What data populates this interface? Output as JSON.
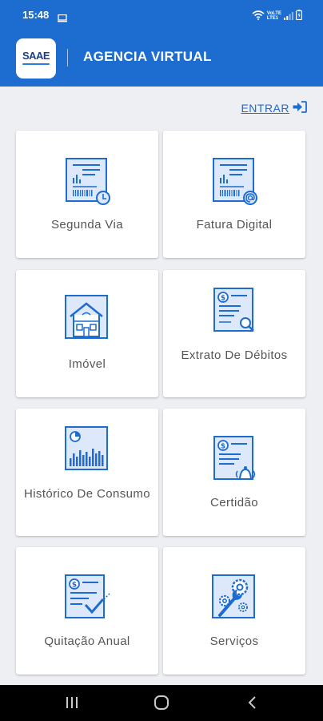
{
  "status_bar": {
    "time": "15:48",
    "network_top": "VoLTE",
    "network_bottom": "LTE1",
    "icons": [
      "monitor-icon",
      "wifi-icon",
      "signal-icon",
      "battery-icon"
    ]
  },
  "app_bar": {
    "logo_text": "SAAE",
    "title": "AGENCIA VIRTUAL",
    "background": "#1d6ccf"
  },
  "login": {
    "label": "ENTRAR",
    "icon": "sign-in-icon"
  },
  "cards": [
    {
      "label": "Segunda Via",
      "icon": "bill-barcode-icon"
    },
    {
      "label": "Fatura Digital",
      "icon": "digital-bill-icon"
    },
    {
      "label": "Imóvel",
      "icon": "house-icon"
    },
    {
      "label": "Extrato De Débitos",
      "icon": "debt-statement-icon"
    },
    {
      "label": "Histórico De Consumo",
      "icon": "consumption-chart-icon"
    },
    {
      "label": "Certidão",
      "icon": "certificate-icon"
    },
    {
      "label": "Quitação Anual",
      "icon": "annual-discharge-icon"
    },
    {
      "label": "Serviços",
      "icon": "services-gears-icon"
    }
  ],
  "nav_bar": {
    "buttons": [
      "recent-apps-icon",
      "home-icon",
      "back-icon"
    ]
  },
  "colors": {
    "accent": "#1d6ccf",
    "icon_fill": "#dde8fa",
    "label": "#555555",
    "background": "#eeeff2"
  }
}
